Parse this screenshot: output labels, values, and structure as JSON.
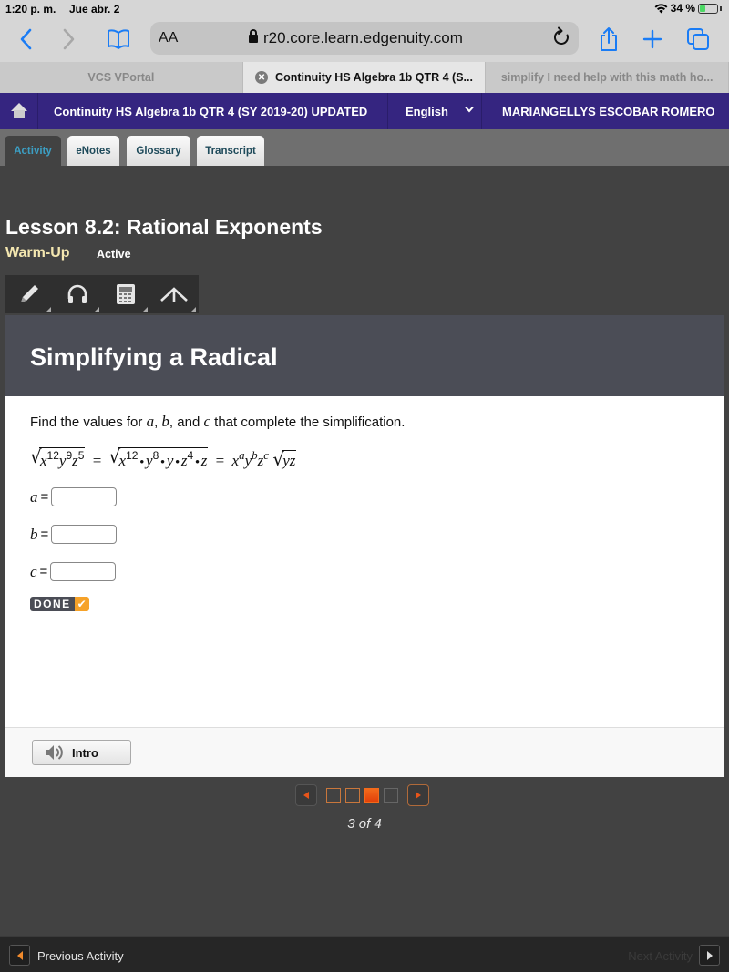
{
  "status_bar": {
    "time": "1:20 p. m.",
    "date": "Jue abr. 2",
    "battery": "34 %",
    "battery_level_percent": 34
  },
  "browser": {
    "text_size_label": "AA",
    "url": "r20.core.learn.edgenuity.com",
    "icons": [
      "back-icon",
      "forward-icon",
      "bookmarks-icon",
      "lock-icon",
      "reload-icon",
      "share-icon",
      "new-tab-icon",
      "tabs-icon"
    ],
    "tabs": [
      {
        "label": "VCS VPortal",
        "active": false
      },
      {
        "label": "Continuity HS Algebra 1b QTR 4 (S...",
        "active": true
      },
      {
        "label": "simplify I need help with this math ho...",
        "active": false
      }
    ]
  },
  "course_header": {
    "course_title": "Continuity HS Algebra 1b QTR 4 (SY 2019-20) UPDATED",
    "language": "English",
    "user_name": "MARIANGELLYS ESCOBAR ROMERO"
  },
  "activity_tabs": [
    {
      "label": "Activity",
      "active": true
    },
    {
      "label": "eNotes",
      "active": false
    },
    {
      "label": "Glossary",
      "active": false
    },
    {
      "label": "Transcript",
      "active": false
    }
  ],
  "lesson": {
    "title": "Lesson 8.2: Rational Exponents",
    "activity_type": "Warm-Up",
    "status": "Active"
  },
  "tools": [
    "pencil-icon",
    "headphones-icon",
    "calculator-icon",
    "reference-icon"
  ],
  "content": {
    "title": "Simplifying a Radical",
    "prompt_before": "Find the values for ",
    "var_a": "a",
    "sep1": ", ",
    "var_b": "b",
    "sep2": ", and ",
    "var_c": "c",
    "prompt_after": " that complete the simplification.",
    "equation": {
      "lhs": {
        "x": "x",
        "x_exp": "12",
        "y": "y",
        "y_exp": "9",
        "z": "z",
        "z_exp": "5"
      },
      "middle": {
        "x": "x",
        "x_exp": "12",
        "y": "y",
        "y_exp": "8",
        "y2": "y",
        "z": "z",
        "z_exp": "4",
        "z2": "z"
      },
      "rhs": {
        "x": "x",
        "x_exp": "a",
        "y": "y",
        "y_exp": "b",
        "z": "z",
        "z_exp": "c",
        "radicand": "yz"
      },
      "dot": "•",
      "equals": "="
    },
    "answers": [
      {
        "var": "a",
        "label": "=",
        "value": ""
      },
      {
        "var": "b",
        "label": "=",
        "value": ""
      },
      {
        "var": "c",
        "label": "=",
        "value": ""
      }
    ],
    "done_label": "DONE",
    "intro_label": "Intro"
  },
  "pager": {
    "current": 3,
    "total": 4,
    "text": "3 of 4"
  },
  "bottom_nav": {
    "previous_label": "Previous Activity",
    "next_label": "Next Activity"
  },
  "colors": {
    "header_purple": "#352580",
    "accent_orange": "#e8551a",
    "active_tab_text": "#3c9fc4",
    "warmup_text": "#f4e7b0"
  }
}
